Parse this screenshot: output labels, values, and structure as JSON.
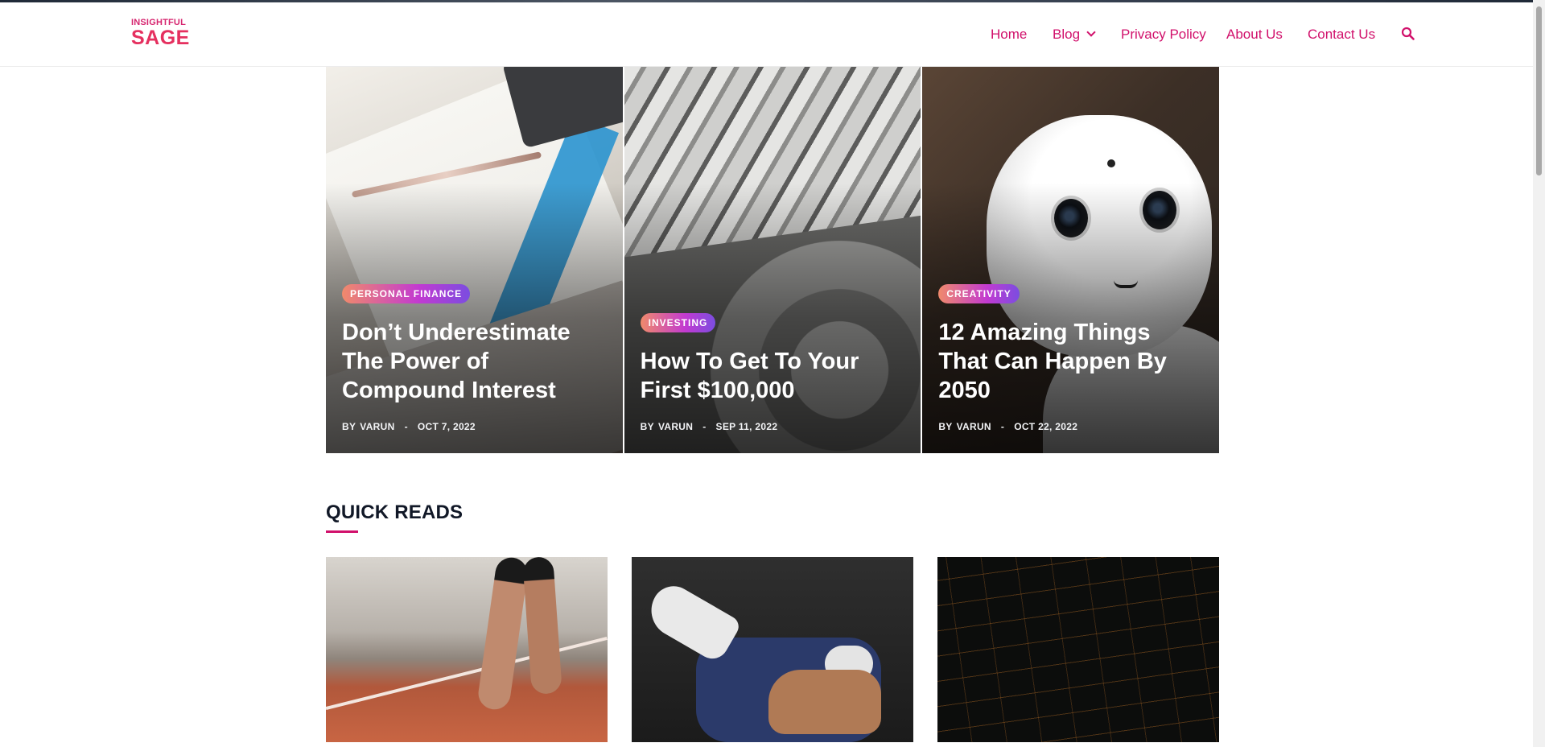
{
  "site": {
    "logo_line1": "INSIGHTFUL",
    "logo_line2": "SAGE"
  },
  "nav": {
    "home": "Home",
    "blog": "Blog",
    "privacy": "Privacy Policy",
    "about": "About Us",
    "contact": "Contact Us",
    "search_icon": "search-icon"
  },
  "hero": [
    {
      "category": "PERSONAL FINANCE",
      "title": "Don’t Underestimate The Power of Compound Interest",
      "by": "BY",
      "author": "VARUN",
      "date": "OCT 7, 2022"
    },
    {
      "category": "INVESTING",
      "title": "How To Get To Your First $100,000",
      "by": "BY",
      "author": "VARUN",
      "date": "SEP 11, 2022"
    },
    {
      "category": "CREATIVITY",
      "title": "12 Amazing Things That Can Happen By 2050",
      "by": "BY",
      "author": "VARUN",
      "date": "OCT 22, 2022"
    }
  ],
  "quick_reads": {
    "heading": "QUICK READS"
  },
  "colors": {
    "accent": "#d1106b",
    "text": "#111827"
  }
}
